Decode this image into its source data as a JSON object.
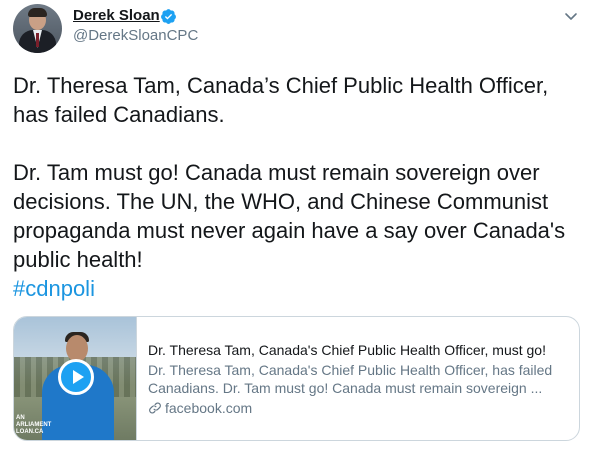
{
  "author": {
    "display_name": "Derek Sloan",
    "handle": "@DerekSloanCPC",
    "verified_icon": "verified-badge-icon",
    "avatar_icon": "avatar"
  },
  "menu_icon": "chevron-down-icon",
  "tweet": {
    "line1": "Dr. Theresa Tam, Canada’s Chief Public Health Officer, has failed Canadians.",
    "line2": "Dr. Tam must go! Canada must remain sovereign over decisions. The UN, the WHO, and Chinese Communist propaganda must never again have a say over Canada's public health!",
    "hashtag": "#cdnpoli"
  },
  "card": {
    "title": "Dr. Theresa Tam, Canada's Chief Public Health Officer, must go!",
    "description": "Dr. Theresa Tam, Canada's Chief Public Health Officer, has failed Canadians. Dr. Tam must go! Canada must remain sovereign ...",
    "domain": "facebook.com",
    "media_watermark": "AN\nARLIAMENT\nLOAN.CA",
    "play_icon": "play-icon",
    "link_icon": "link-icon"
  },
  "colors": {
    "accent": "#1da1f2",
    "hashtag": "#1b95e0",
    "secondary_text": "#657786",
    "border": "#ccd6dd"
  }
}
